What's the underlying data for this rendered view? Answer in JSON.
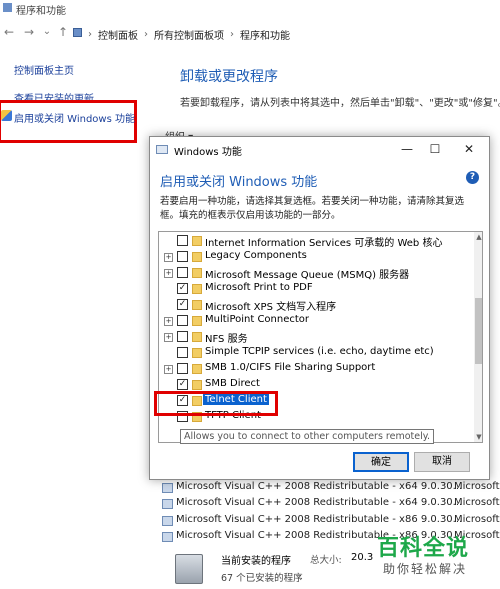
{
  "window": {
    "title": "程序和功能"
  },
  "nav": {
    "back": "←",
    "forward": "→",
    "dropdown": "⌄",
    "up": "↑",
    "breadcrumbs": [
      "控制面板",
      "所有控制面板项",
      "程序和功能"
    ]
  },
  "sidebar": {
    "home": "控制面板主页",
    "updates": "查看已安装的更新",
    "features": "启用或关闭 Windows 功能"
  },
  "main": {
    "title": "卸载或更改程序",
    "description": "若要卸载程序，请从列表中将其选中，然后单击\"卸载\"、\"更改\"或\"修复\"。",
    "organize": "组织 ▾",
    "programs": [
      {
        "name": "Microsoft Visual C++ 2008 Redistributable - x64 9.0.30...",
        "publisher": "Microsoft"
      },
      {
        "name": "Microsoft Visual C++ 2008 Redistributable - x64 9.0.30...",
        "publisher": "Microsoft"
      },
      {
        "name": "Microsoft Visual C++ 2008 Redistributable - x86 9.0.30...",
        "publisher": "Microsoft"
      },
      {
        "name": "Microsoft Visual C++ 2008 Redistributable - x86 9.0.30...",
        "publisher": "Microsoft"
      }
    ]
  },
  "statusbar": {
    "label": "当前安装的程序",
    "size_label": "总大小:",
    "size_value": "20.3",
    "count": "67 个已安装的程序"
  },
  "dialog": {
    "title": "Windows 功能",
    "heading": "启用或关闭 Windows 功能",
    "description": "若要启用一种功能，请选择其复选框。若要关闭一种功能，请清除其复选框。填充的框表示仅启用该功能的一部分。",
    "features": [
      {
        "label": "Internet Information Services 可承载的 Web 核心",
        "expandable": false,
        "checked": false
      },
      {
        "label": "Legacy Components",
        "expandable": true,
        "checked": false
      },
      {
        "label": "Microsoft Message Queue (MSMQ) 服务器",
        "expandable": true,
        "checked": false
      },
      {
        "label": "Microsoft Print to PDF",
        "expandable": false,
        "checked": true
      },
      {
        "label": "Microsoft XPS 文档写入程序",
        "expandable": false,
        "checked": true
      },
      {
        "label": "MultiPoint Connector",
        "expandable": true,
        "checked": false
      },
      {
        "label": "NFS 服务",
        "expandable": true,
        "checked": false
      },
      {
        "label": "Simple TCPIP services (i.e. echo, daytime etc)",
        "expandable": false,
        "checked": false
      },
      {
        "label": "SMB 1.0/CIFS File Sharing Support",
        "expandable": true,
        "checked": false
      },
      {
        "label": "SMB Direct",
        "expandable": false,
        "checked": true
      },
      {
        "label": "Telnet Client",
        "expandable": false,
        "checked": true
      },
      {
        "label": "TFTP Client",
        "expandable": false,
        "checked": false
      }
    ],
    "tooltip": "Allows you to connect to other computers remotely.",
    "ok": "确定",
    "cancel": "取消",
    "minimize": "—",
    "maximize": "☐",
    "close": "✕",
    "help": "?"
  },
  "watermark": {
    "main": "百科全说",
    "sub": "助你轻松解决"
  },
  "colors": {
    "highlight": "#0a62cf",
    "annotation_red": "#e00000",
    "link_blue": "#1a3f9a",
    "heading_blue": "#1f5db5",
    "watermark_green": "#1ea84a"
  }
}
